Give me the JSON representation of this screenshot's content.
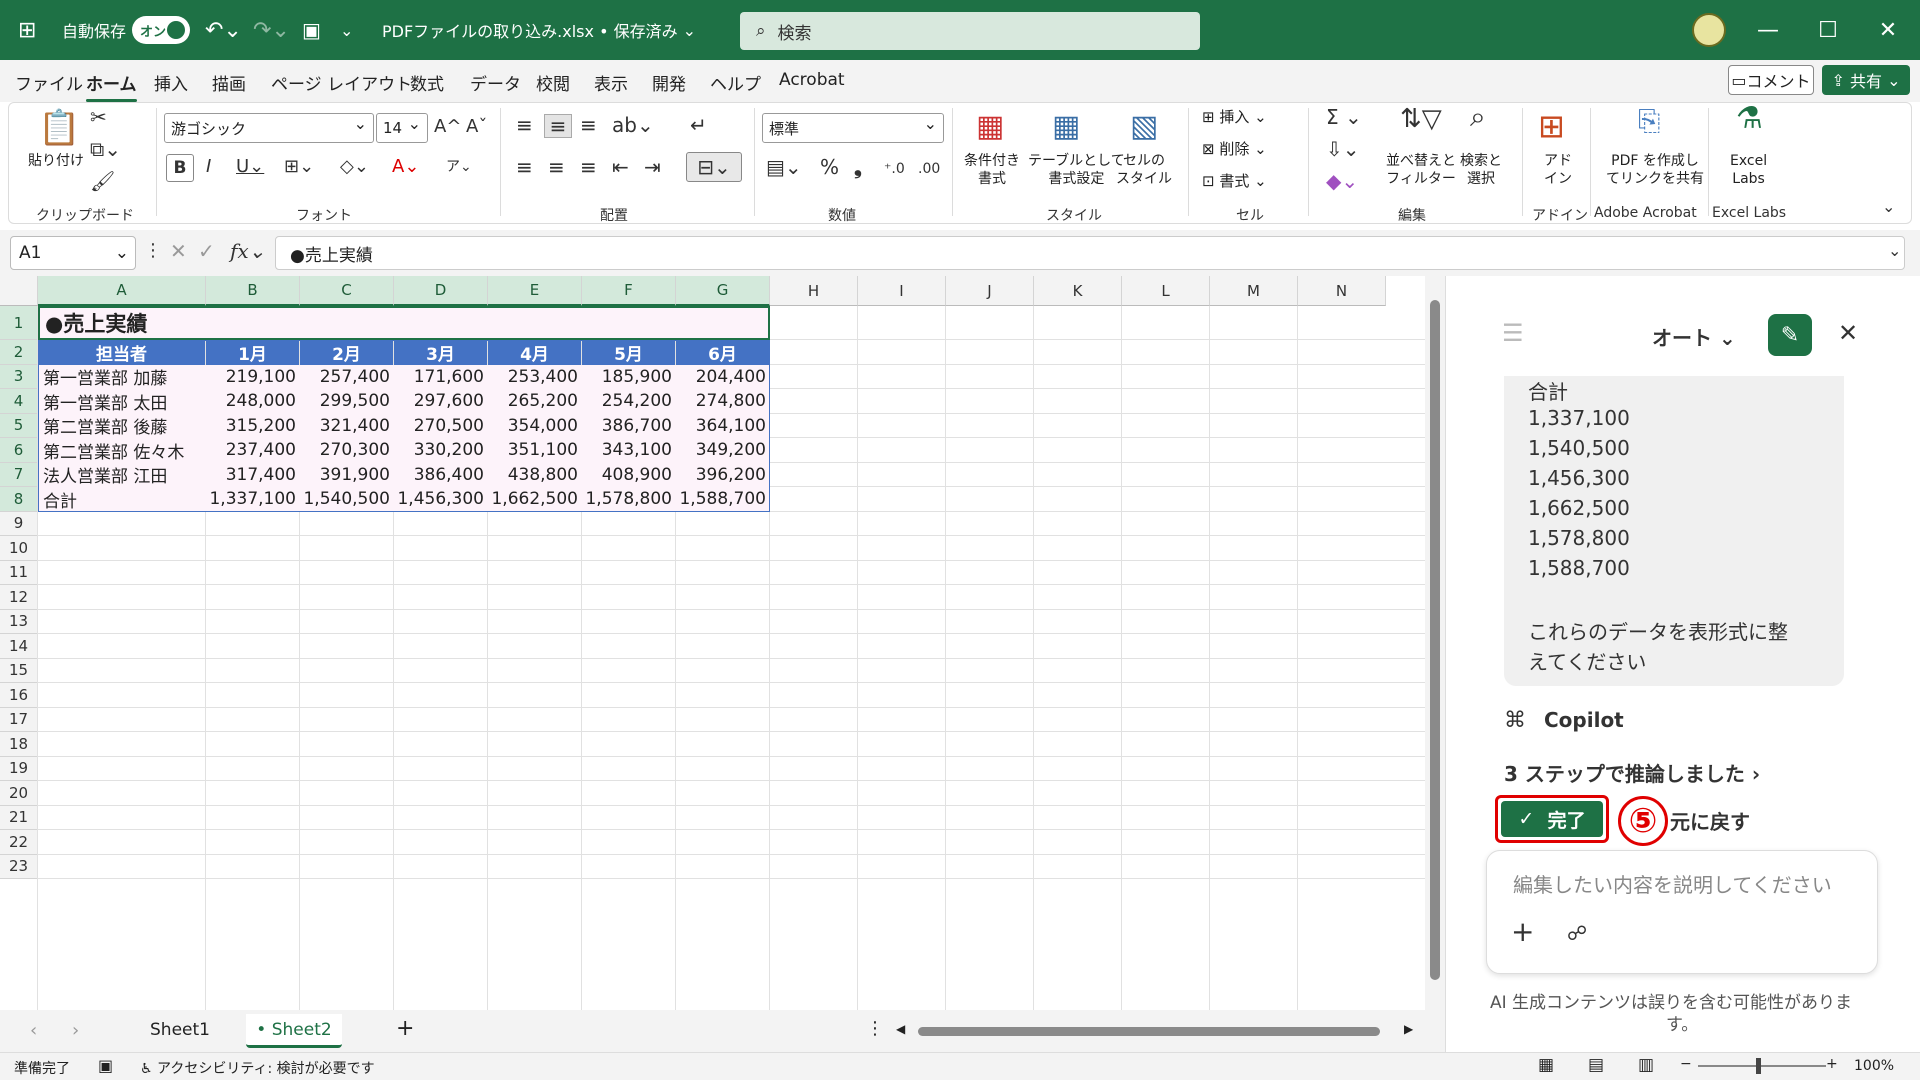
{
  "titlebar": {
    "autosave_label": "自動保存",
    "autosave_state": "オン",
    "file_title": "PDFファイルの取り込み.xlsx • 保存済み",
    "search_placeholder": "検索"
  },
  "menu": {
    "tabs": [
      "ファイル",
      "ホーム",
      "挿入",
      "描画",
      "ページ レイアウト",
      "数式",
      "データ",
      "校閲",
      "表示",
      "開発",
      "ヘルプ",
      "Acrobat"
    ],
    "active": "ホーム",
    "comment_label": "コメント",
    "share_label": "共有"
  },
  "ribbon": {
    "paste": "貼り付け",
    "clipboard_group": "クリップボード",
    "font_name": "游ゴシック",
    "font_size": "14",
    "font_group": "フォント",
    "align_group": "配置",
    "number_format": "標準",
    "number_group": "数値",
    "cond_format": "条件付き\n書式",
    "table_format": "テーブルとして\n書式設定",
    "cell_style": "セルの\nスタイル",
    "style_group": "スタイル",
    "insert": "挿入",
    "delete": "削除",
    "format": "書式",
    "cell_group": "セル",
    "sort_filter": "並べ替えと\nフィルター",
    "find_select": "検索と\n選択",
    "edit_group": "編集",
    "addin": "アド\nイン",
    "addin_group": "アドイン",
    "pdf_link": "PDF を作成し\nてリンクを共有",
    "acrobat_group": "Adobe Acrobat",
    "excel_labs": "Excel\nLabs",
    "labs_group": "Excel Labs"
  },
  "formula": {
    "namebox": "A1",
    "content": "●売上実績"
  },
  "columns": [
    "A",
    "B",
    "C",
    "D",
    "E",
    "F",
    "G",
    "H",
    "I",
    "J",
    "K",
    "L",
    "M",
    "N"
  ],
  "rows": [
    "1",
    "2",
    "3",
    "4",
    "5",
    "6",
    "7",
    "8",
    "9",
    "10",
    "11",
    "12",
    "13",
    "14",
    "15",
    "16",
    "17",
    "18",
    "19",
    "20",
    "21",
    "22",
    "23"
  ],
  "table": {
    "title": "●売上実績",
    "headers": [
      "担当者",
      "1月",
      "2月",
      "3月",
      "4月",
      "5月",
      "6月"
    ],
    "rows": [
      [
        "第一営業部 加藤",
        "219,100",
        "257,400",
        "171,600",
        "253,400",
        "185,900",
        "204,400"
      ],
      [
        "第一営業部 太田",
        "248,000",
        "299,500",
        "297,600",
        "265,200",
        "254,200",
        "274,800"
      ],
      [
        "第二営業部 後藤",
        "315,200",
        "321,400",
        "270,500",
        "354,000",
        "386,700",
        "364,100"
      ],
      [
        "第二営業部 佐々木",
        "237,400",
        "270,300",
        "330,200",
        "351,100",
        "343,100",
        "349,200"
      ],
      [
        "法人営業部 江田",
        "317,400",
        "391,900",
        "386,400",
        "438,800",
        "408,900",
        "396,200"
      ],
      [
        "合計",
        "1,337,100",
        "1,540,500",
        "1,456,300",
        "1,662,500",
        "1,578,800",
        "1,588,700"
      ]
    ]
  },
  "sheets": {
    "tabs": [
      "Sheet1",
      "• Sheet2"
    ],
    "active": "• Sheet2"
  },
  "status": {
    "ready": "準備完了",
    "accessibility": "アクセシビリティ: 検討が必要です",
    "zoom": "100%"
  },
  "copilot": {
    "mode": "オート",
    "bubble_lines": [
      "合計",
      "1,337,100",
      "1,540,500",
      "1,456,300",
      "1,662,500",
      "1,578,800",
      "1,588,700"
    ],
    "bubble_request": [
      "これらのデータを表形式に整",
      "えてください"
    ],
    "name": "Copilot",
    "reasoning": "3 ステップで推論しました",
    "done_label": "完了",
    "undo_label": "元に戻す",
    "step_marker": "⑤",
    "input_placeholder": "編集したい内容を説明してください",
    "disclaimer_1": "AI 生成コンテンツは誤りを含む可能性がありま",
    "disclaimer_2": "す。"
  },
  "colors": {
    "excel_green": "#1e7145",
    "table_header": "#4472c4",
    "highlight_red": "#e00000"
  }
}
